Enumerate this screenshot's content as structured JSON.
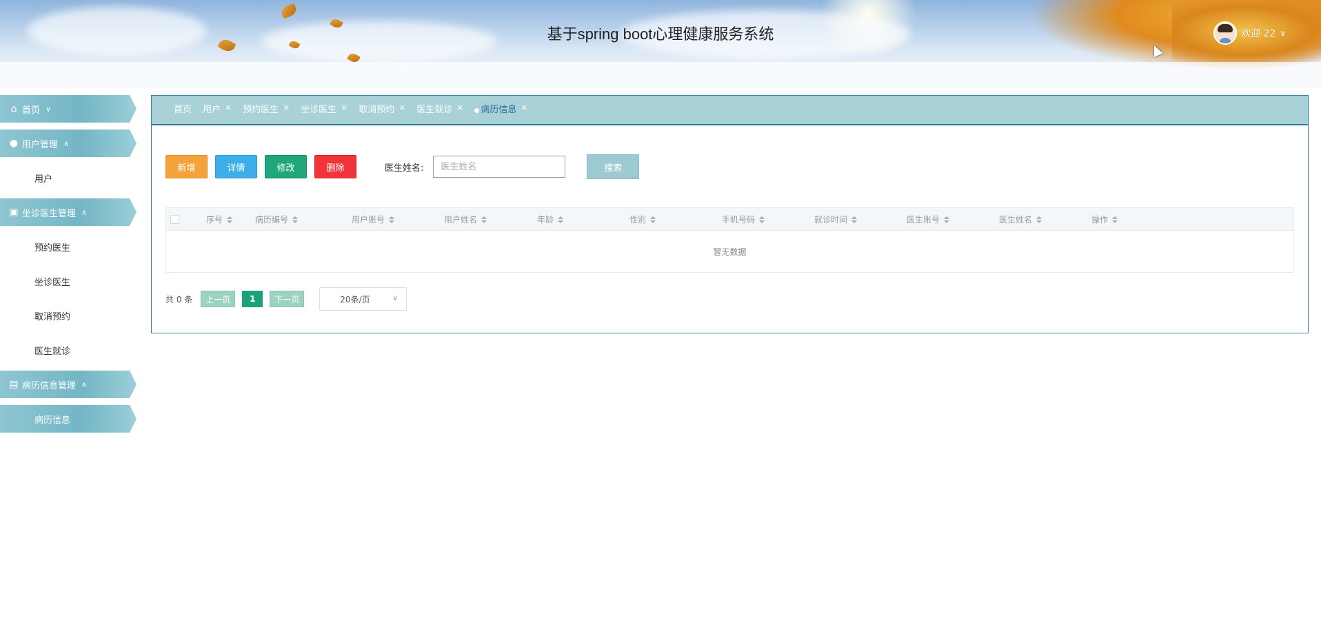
{
  "header": {
    "title": "基于spring boot心理健康服务系统",
    "welcome": "欢迎 22",
    "dropdown_icon": "chevron-down-icon"
  },
  "sidebar": {
    "groups": [
      {
        "label": "首页",
        "icon": "home-icon",
        "arrow": "∨"
      },
      {
        "label": "用户管理",
        "icon": "user-icon",
        "arrow": "∧",
        "items": [
          "用户"
        ]
      },
      {
        "label": "坐诊医生管理",
        "icon": "briefcase-icon",
        "arrow": "∧",
        "items": [
          "预约医生",
          "坐诊医生",
          "取消预约",
          "医生就诊"
        ]
      },
      {
        "label": "病历信息管理",
        "icon": "book-icon",
        "arrow": "∧",
        "items": [
          "病历信息"
        ]
      }
    ],
    "active_item": "病历信息"
  },
  "tabs": [
    {
      "label": "首页"
    },
    {
      "label": "用户",
      "close": "×"
    },
    {
      "label": "预约医生",
      "close": "×"
    },
    {
      "label": "坐诊医生",
      "close": "×"
    },
    {
      "label": "取消预约",
      "close": "×"
    },
    {
      "label": "医生就诊",
      "close": "×"
    },
    {
      "label": "病历信息",
      "close": "×",
      "active": true
    }
  ],
  "toolbar": {
    "add": "新增",
    "detail": "详情",
    "edit": "修改",
    "delete": "删除",
    "search_label": "医生姓名:",
    "search_placeholder": "医生姓名",
    "search_button": "搜索"
  },
  "table": {
    "columns": [
      "序号",
      "病历编号",
      "用户账号",
      "用户姓名",
      "年龄",
      "性别",
      "手机号码",
      "就诊时间",
      "医生账号",
      "医生姓名",
      "操作"
    ],
    "empty_text": "暂无数据"
  },
  "pager": {
    "total": "共 0 条",
    "prev": "上一页",
    "page": "1",
    "next": "下一页",
    "page_size": "20条/页"
  },
  "colors": {
    "accent": "#74b6c6",
    "add": "#f6a23a",
    "detail": "#3eaee8",
    "edit": "#1fa67a",
    "delete": "#f0343a"
  }
}
